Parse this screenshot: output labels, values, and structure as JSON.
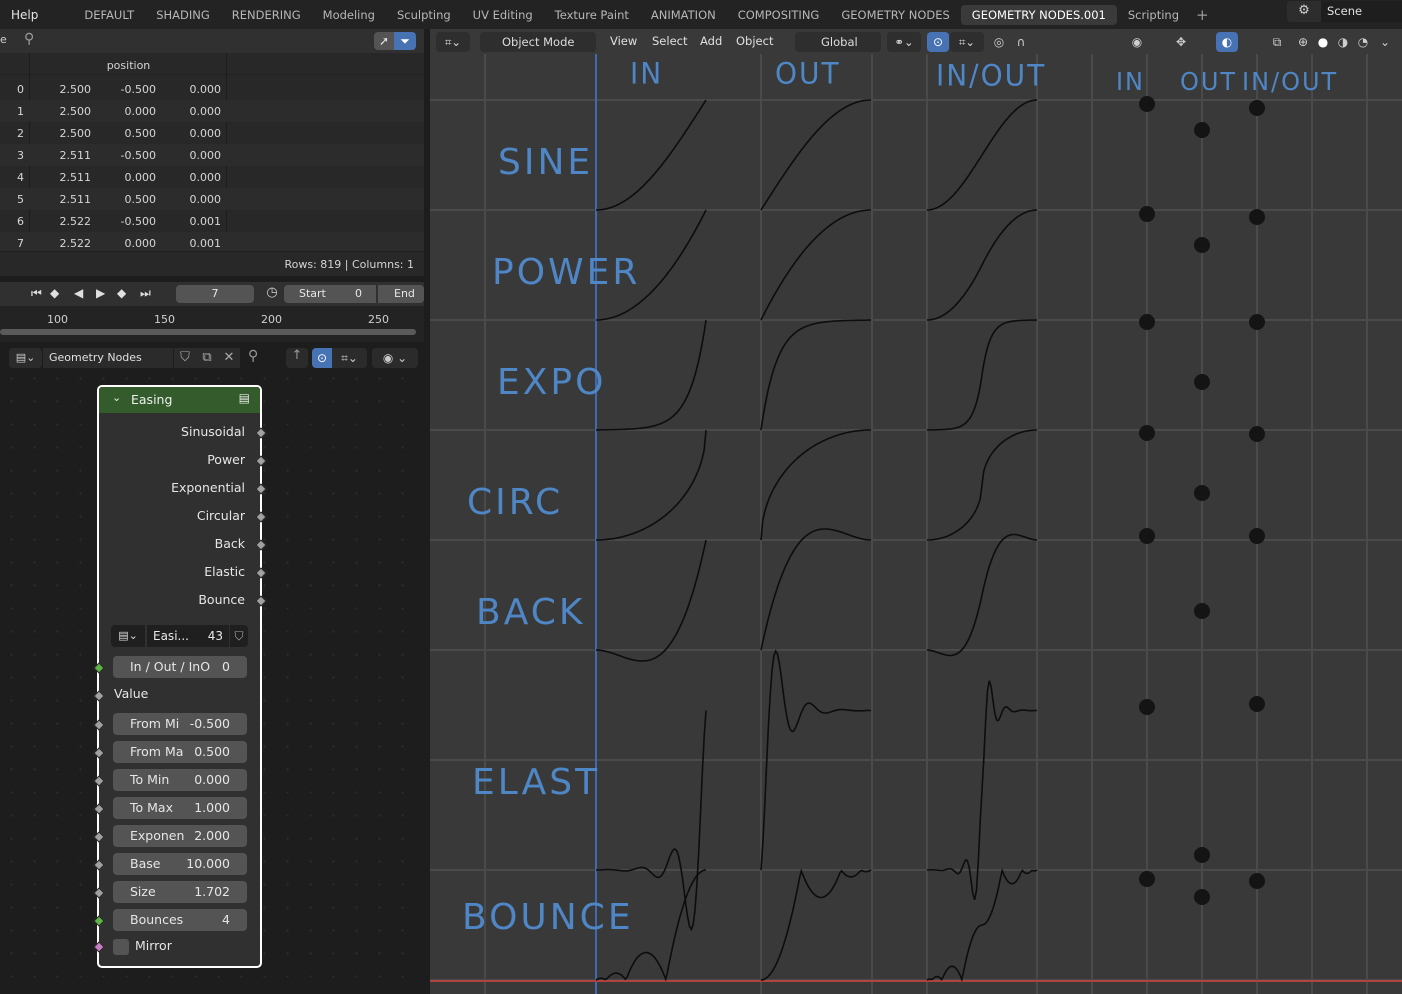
{
  "topbar": {
    "menus": [
      "Help"
    ],
    "workspaces": [
      "DEFAULT",
      "SHADING",
      "RENDERING",
      "Modeling",
      "Sculpting",
      "UV Editing",
      "Texture Paint",
      "ANIMATION",
      "COMPOSITING",
      "GEOMETRY NODES",
      "GEOMETRY NODES.001",
      "Scripting"
    ],
    "active_workspace": "GEOMETRY NODES.001",
    "add_label": "+",
    "scene_name": "Scene"
  },
  "spreadsheet": {
    "left_cut_label": "e",
    "column_header": "position",
    "rows": [
      {
        "i": "0",
        "x": "2.500",
        "y": "-0.500",
        "z": "0.000"
      },
      {
        "i": "1",
        "x": "2.500",
        "y": "0.000",
        "z": "0.000"
      },
      {
        "i": "2",
        "x": "2.500",
        "y": "0.500",
        "z": "0.000"
      },
      {
        "i": "3",
        "x": "2.511",
        "y": "-0.500",
        "z": "0.000"
      },
      {
        "i": "4",
        "x": "2.511",
        "y": "0.000",
        "z": "0.000"
      },
      {
        "i": "5",
        "x": "2.511",
        "y": "0.500",
        "z": "0.000"
      },
      {
        "i": "6",
        "x": "2.522",
        "y": "-0.500",
        "z": "0.001"
      },
      {
        "i": "7",
        "x": "2.522",
        "y": "0.000",
        "z": "0.001"
      }
    ],
    "footer": "Rows: 819   |   Columns: 1"
  },
  "timeline": {
    "current_frame": "7",
    "start_label": "Start",
    "start_value": "0",
    "end_label": "End",
    "ruler": [
      "100",
      "150",
      "200",
      "250"
    ]
  },
  "node_editor": {
    "tree_name": "Geometry Nodes",
    "node": {
      "title": "Easing",
      "outputs": [
        "Sinusoidal",
        "Power",
        "Exponential",
        "Circular",
        "Back",
        "Elastic",
        "Bounce"
      ],
      "group_name": "Easi...",
      "group_users": "43",
      "inputs": [
        {
          "label": "In / Out / InO",
          "value": "0"
        },
        {
          "label": "From Mi",
          "value": "-0.500"
        },
        {
          "label": "From Ma",
          "value": "0.500"
        },
        {
          "label": "To Min",
          "value": "0.000"
        },
        {
          "label": "To Max",
          "value": "1.000"
        },
        {
          "label": "Exponen",
          "value": "2.000"
        },
        {
          "label": "Base",
          "value": "10.000"
        },
        {
          "label": "Size",
          "value": "1.702"
        },
        {
          "label": "Bounces",
          "value": "4"
        }
      ],
      "value_label": "Value",
      "mirror_label": "Mirror"
    }
  },
  "viewport": {
    "mode": "Object Mode",
    "menus": [
      "View",
      "Select",
      "Add",
      "Object"
    ],
    "orientation": "Global",
    "handwritten_columns": [
      "IN",
      "OUT",
      "IN/OUT",
      "IN",
      "OUT",
      "IN/OUT"
    ],
    "handwritten_rows": [
      "SINE",
      "POWER",
      "EXPO",
      "CIRC",
      "BACK",
      "ELAST",
      "BOUNCE"
    ],
    "colors": {
      "ink": "#4f86c6",
      "axis": "#3e6bb0",
      "red_axis": "#b0423f",
      "grid": "#4a4a4a"
    }
  }
}
